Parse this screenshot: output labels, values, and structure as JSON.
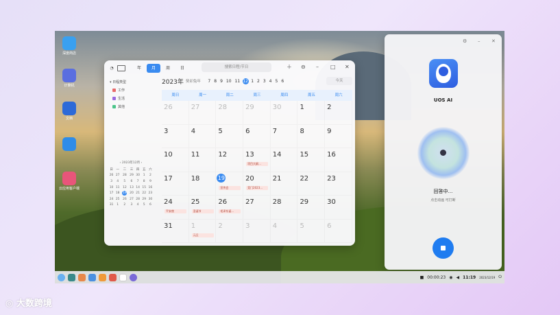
{
  "desktop": {
    "icons": [
      {
        "label": "深度商店",
        "color": "#3aa0f0"
      },
      {
        "label": "计算机",
        "color": "#5a6ee0"
      },
      {
        "label": "文档",
        "color": "#2d6ad8"
      },
      {
        "label": "",
        "color": "#2e8ce8"
      },
      {
        "label": "云应用客户端",
        "color": "#e8557a"
      }
    ]
  },
  "calendar": {
    "views": [
      "年",
      "月",
      "周",
      "日"
    ],
    "active_view": "月",
    "search_placeholder": "搜索日程/节日",
    "year_label": "2023年",
    "lunar_label": "癸卯兔年",
    "months": [
      "7",
      "8",
      "9",
      "10",
      "11",
      "12",
      "1",
      "2",
      "3",
      "4",
      "5",
      "6"
    ],
    "selected_month": "12",
    "today_button": "今天",
    "sidebar_title": "日程类型",
    "sidebar_types": [
      {
        "label": "工作",
        "color": "#e86a6a"
      },
      {
        "label": "生活",
        "color": "#9a6ae0"
      },
      {
        "label": "其他",
        "color": "#4ac48a"
      }
    ],
    "mini_title": "2023年12月",
    "mini_weekdays": [
      "日",
      "一",
      "二",
      "三",
      "四",
      "五",
      "六"
    ],
    "mini_days": [
      [
        "26",
        "27",
        "28",
        "29",
        "30",
        "1",
        "2"
      ],
      [
        "3",
        "4",
        "5",
        "6",
        "7",
        "8",
        "9"
      ],
      [
        "10",
        "11",
        "12",
        "13",
        "14",
        "15",
        "16"
      ],
      [
        "17",
        "18",
        "19",
        "20",
        "21",
        "22",
        "23"
      ],
      [
        "24",
        "25",
        "26",
        "27",
        "28",
        "29",
        "30"
      ],
      [
        "31",
        "1",
        "2",
        "3",
        "4",
        "5",
        "6"
      ]
    ],
    "weekdays": [
      "周日",
      "周一",
      "周二",
      "周三",
      "周四",
      "周五",
      "周六"
    ],
    "weeks": [
      [
        {
          "n": "26",
          "o": true
        },
        {
          "n": "27",
          "o": true
        },
        {
          "n": "28",
          "o": true
        },
        {
          "n": "29",
          "o": true
        },
        {
          "n": "30",
          "o": true
        },
        {
          "n": "1"
        },
        {
          "n": "2"
        }
      ],
      [
        {
          "n": "3"
        },
        {
          "n": "4"
        },
        {
          "n": "5"
        },
        {
          "n": "6"
        },
        {
          "n": "7"
        },
        {
          "n": "8"
        },
        {
          "n": "9"
        }
      ],
      [
        {
          "n": "10"
        },
        {
          "n": "11"
        },
        {
          "n": "12"
        },
        {
          "n": "13",
          "ev": "项目大纲..."
        },
        {
          "n": "14"
        },
        {
          "n": "15"
        },
        {
          "n": "16"
        }
      ],
      [
        {
          "n": "17"
        },
        {
          "n": "18"
        },
        {
          "n": "19",
          "today": true,
          "ev": "宣传会"
        },
        {
          "n": "20",
          "ev": "竞门2023..."
        },
        {
          "n": "21"
        },
        {
          "n": "22"
        },
        {
          "n": "23"
        }
      ],
      [
        {
          "n": "24",
          "ev": "平安夜"
        },
        {
          "n": "25",
          "ev": "圣诞节"
        },
        {
          "n": "26",
          "ev": "毛泽东诞..."
        },
        {
          "n": "27"
        },
        {
          "n": "28"
        },
        {
          "n": "29"
        },
        {
          "n": "30"
        }
      ],
      [
        {
          "n": "31"
        },
        {
          "n": "1",
          "o": true,
          "ev": "元旦"
        },
        {
          "n": "2",
          "o": true
        },
        {
          "n": "3",
          "o": true
        },
        {
          "n": "4",
          "o": true
        },
        {
          "n": "5",
          "o": true
        },
        {
          "n": "6",
          "o": true
        }
      ]
    ]
  },
  "assistant": {
    "name": "UOS AI",
    "status": "回答中...",
    "hint": "点击动画 可打断"
  },
  "taskbar": {
    "tray_time": "11:19",
    "tray_date": "2023/12/19",
    "recording_time": "00:00:23"
  },
  "watermark": "大数跨境"
}
